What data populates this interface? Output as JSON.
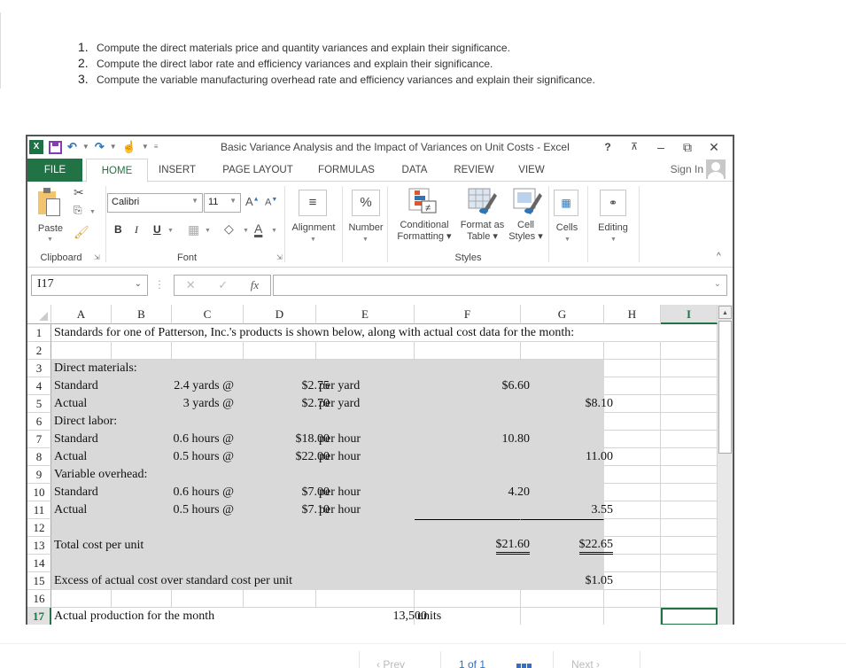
{
  "questions": [
    {
      "num": "1.",
      "text": "Compute the direct materials price and quantity variances and explain their significance."
    },
    {
      "num": "2.",
      "text": "Compute the direct labor rate and efficiency variances and explain their significance."
    },
    {
      "num": "3.",
      "text": "Compute the variable manufacturing overhead rate and efficiency variances and explain their significance."
    }
  ],
  "window": {
    "title": "Basic Variance Analysis and the Impact of Variances on Unit Costs - Excel",
    "app_icon": "excel-icon",
    "qat_icons": [
      "save-icon",
      "undo-icon",
      "redo-icon",
      "touch-mode-icon",
      "customize-qat-icon"
    ],
    "controls": {
      "help": "?",
      "ribbon_display": "⍐",
      "minimize": "–",
      "restore": "🗗",
      "close": "✕"
    }
  },
  "tabs": [
    {
      "label": "FILE",
      "state": "file"
    },
    {
      "label": "HOME",
      "state": "active"
    },
    {
      "label": "INSERT"
    },
    {
      "label": "PAGE LAYOUT"
    },
    {
      "label": "FORMULAS"
    },
    {
      "label": "DATA"
    },
    {
      "label": "REVIEW"
    },
    {
      "label": "VIEW"
    }
  ],
  "signin": "Sign In",
  "ribbon": {
    "clipboard": {
      "paste": "Paste",
      "group": "Clipboard"
    },
    "font": {
      "name": "Calibri",
      "size": "11",
      "bold": "B",
      "italic": "I",
      "underline": "U",
      "group": "Font"
    },
    "alignment": {
      "label": "Alignment"
    },
    "number": {
      "label": "Number",
      "icon": "%"
    },
    "styles": {
      "conditional": [
        "Conditional",
        "Formatting"
      ],
      "format_table": [
        "Format as",
        "Table"
      ],
      "cell_styles": [
        "Cell",
        "Styles"
      ],
      "group": "Styles"
    },
    "cells": {
      "label": "Cells"
    },
    "editing": {
      "label": "Editing"
    }
  },
  "formula_bar": {
    "name_box": "I17",
    "formula": "",
    "fx": "fx"
  },
  "columns": [
    "A",
    "B",
    "C",
    "D",
    "E",
    "F",
    "G",
    "H",
    "I"
  ],
  "selected_column": "I",
  "selected_row": "17",
  "rows": {
    "r1": "Standards for one of Patterson, Inc.'s products is shown below, along with actual cost data for the month:",
    "r3": "Direct materials:",
    "r4": {
      "label": "Standard",
      "qty": "2.4 yards @",
      "price": "$2.75",
      "unit": "per yard",
      "standard_total": "$6.60"
    },
    "r5": {
      "label": "Actual",
      "qty": "3 yards @",
      "price": "$2.70",
      "unit": "per yard",
      "actual_total": "$8.10"
    },
    "r6": "Direct labor:",
    "r7": {
      "label": "Standard",
      "qty": "0.6 hours @",
      "price": "$18.00",
      "unit": "per hour",
      "standard_total": "10.80"
    },
    "r8": {
      "label": "Actual",
      "qty": "0.5 hours @",
      "price": "$22.00",
      "unit": "per hour",
      "actual_total": "11.00"
    },
    "r9": "Variable overhead:",
    "r10": {
      "label": "Standard",
      "qty": "0.6 hours @",
      "price": "$7.00",
      "unit": "per hour",
      "standard_total": "4.20"
    },
    "r11": {
      "label": "Actual",
      "qty": "0.5 hours @",
      "price": "$7.10",
      "unit": "per hour",
      "actual_total": "3.55"
    },
    "r13": {
      "label": "Total cost per unit",
      "standard_total": "$21.60",
      "actual_total": "$22.65"
    },
    "r15": {
      "label": "Excess of actual cost over standard cost per unit",
      "actual_total": "$1.05"
    },
    "r17": {
      "label": "Actual production for the month",
      "value": "13,500",
      "unit": "units"
    }
  },
  "pager": {
    "prev": "‹ Prev",
    "page": "1 of 1",
    "next": "Next ›"
  }
}
